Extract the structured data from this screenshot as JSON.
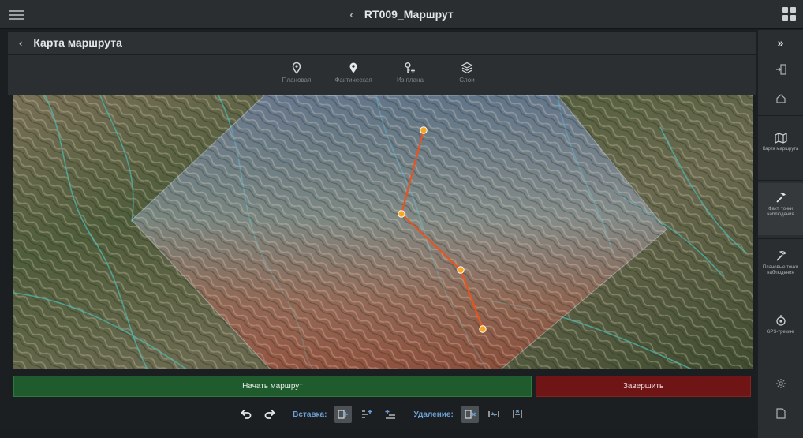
{
  "app": {
    "title": "RT009_Маршрут",
    "back_glyph": "‹"
  },
  "page": {
    "title": "Карта маршрута",
    "back_glyph": "‹"
  },
  "map_toolbar": [
    {
      "id": "planned",
      "label": "Плановая",
      "icon": "map-pin-outline-icon"
    },
    {
      "id": "actual",
      "label": "Фактическая",
      "icon": "map-pin-filled-icon"
    },
    {
      "id": "from_plan",
      "label": "Из плана",
      "icon": "key-plus-icon"
    },
    {
      "id": "layers",
      "label": "Слои",
      "icon": "layers-icon"
    }
  ],
  "map": {
    "route_color": "#e8541e",
    "point_color": "#f5a623"
  },
  "actions": {
    "start_label": "Начать маршрут",
    "finish_label": "Завершить",
    "start_color": "#1f5b2d",
    "finish_color": "#6f1515"
  },
  "edit_toolbar": {
    "undo_icon": "undo-icon",
    "redo_icon": "redo-icon",
    "insert_label": "Вставка:",
    "delete_label": "Удаление:"
  },
  "sidebar": {
    "collapse_glyph": "»",
    "items": [
      {
        "id": "map",
        "label": "Карта маршрута",
        "icon": "map-icon"
      },
      {
        "id": "actual_points",
        "label": "Факт. точки наблюдения",
        "icon": "pick-hammer-icon"
      },
      {
        "id": "planned_points",
        "label": "Плановые точки наблюдения",
        "icon": "pick-hammer-outline-icon"
      },
      {
        "id": "gps",
        "label": "GPS-трекинг",
        "icon": "gps-tracking-icon"
      }
    ]
  }
}
